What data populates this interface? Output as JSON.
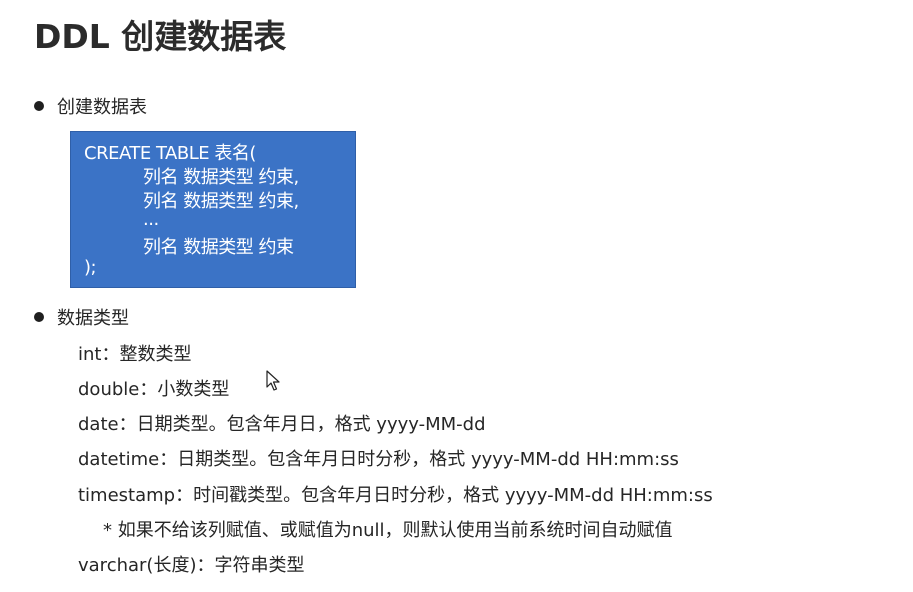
{
  "title": "DDL 创建数据表",
  "section_create": {
    "bullet": "创建数据表",
    "code_lines": [
      "CREATE TABLE 表名(",
      "列名 数据类型 约束,",
      "列名 数据类型 约束,",
      "...",
      "列名 数据类型 约束",
      ");"
    ]
  },
  "section_types": {
    "bullet": "数据类型",
    "items": [
      "int：整数类型",
      "double：小数类型",
      "date：日期类型。包含年月日，格式 yyyy-MM-dd",
      "datetime：日期类型。包含年月日时分秒，格式 yyyy-MM-dd HH:mm:ss",
      "timestamp：时间戳类型。包含年月日时分秒，格式 yyyy-MM-dd HH:mm:ss",
      "* 如果不给该列赋值、或赋值为null，则默认使用当前系统时间自动赋值",
      "varchar(长度)：字符串类型"
    ]
  },
  "colors": {
    "code_box_background": "#3b73c6",
    "code_text": "#ffffff",
    "body_text": "#262626"
  },
  "icons": {
    "bullet": "filled-circle",
    "cursor": "mouse-pointer-arrow"
  }
}
